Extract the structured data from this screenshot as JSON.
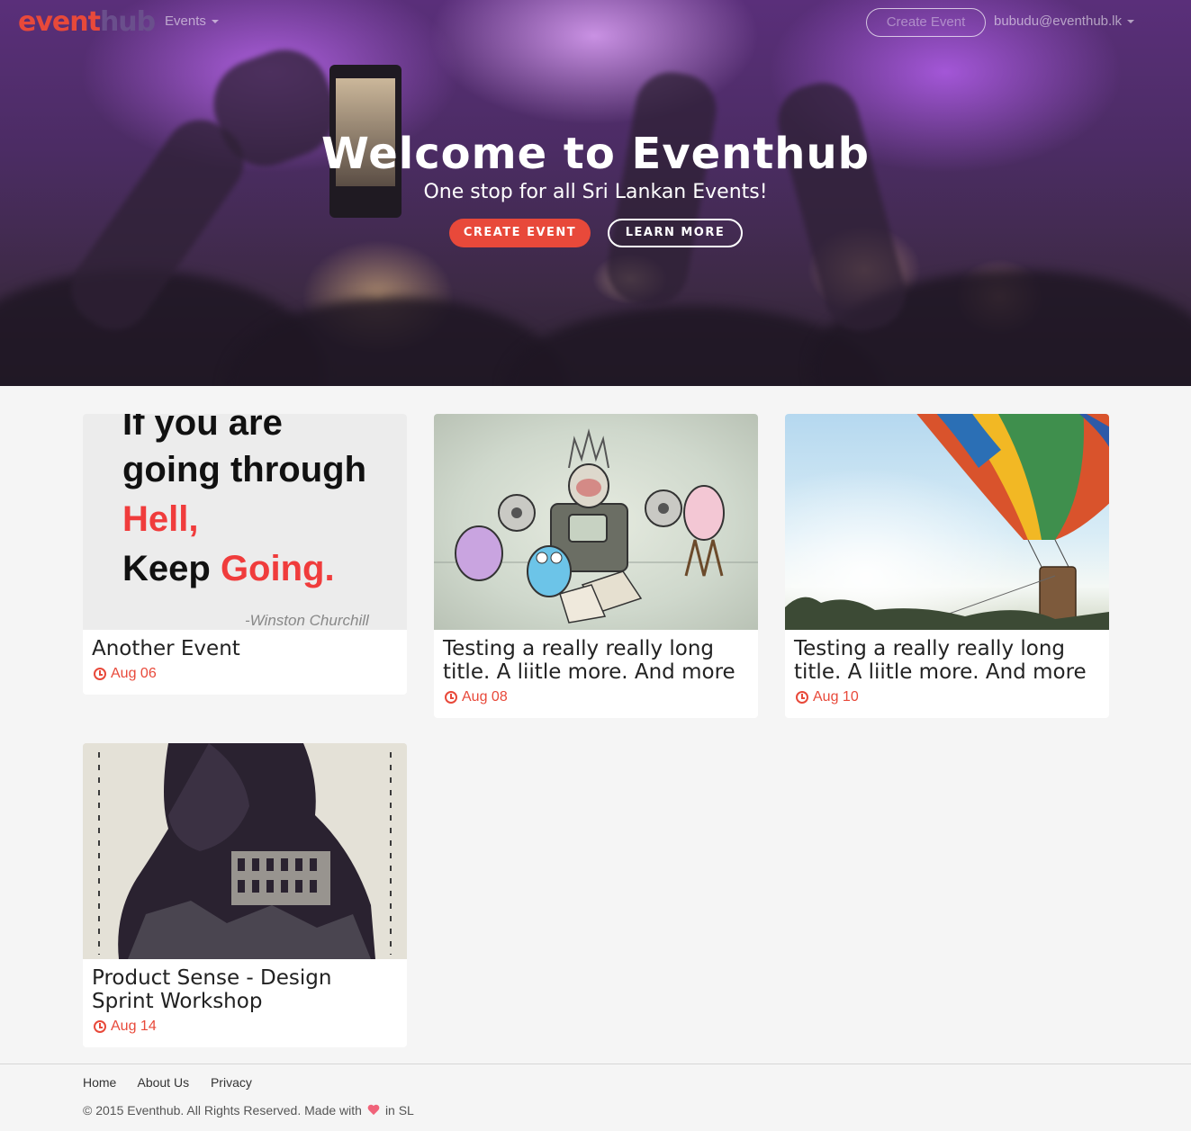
{
  "nav": {
    "logo_part1": "event",
    "logo_part2": "hub",
    "events_menu": "Events",
    "create_event": "Create Event",
    "user_email": "bubudu@eventhub.lk"
  },
  "hero": {
    "title": "Welcome to Eventhub",
    "subtitle": "One stop for all Sri Lankan Events!",
    "primary_button": "CREATE EVENT",
    "secondary_button": "LEARN MORE"
  },
  "events": [
    {
      "title": "Another Event",
      "date": "Aug 06",
      "image": {
        "lines": [
          "If you are",
          "going through",
          "Hell,",
          "Keep",
          "Going."
        ],
        "author": "-Winston Churchill"
      }
    },
    {
      "title": "Testing a really really long title. A liitle more. And more",
      "date": "Aug 08"
    },
    {
      "title": "Testing a really really long title. A liitle more. And more",
      "date": "Aug 10"
    },
    {
      "title": "Product Sense - Design Sprint Workshop",
      "date": "Aug 14"
    }
  ],
  "footer": {
    "links": [
      "Home",
      "About Us",
      "Privacy"
    ],
    "copy_before": "© 2015 Eventhub. All Rights Reserved. Made with",
    "copy_after": "in SL"
  },
  "colors": {
    "accent": "#e8493a",
    "background": "#f5f5f5",
    "heart": "#f0637a"
  }
}
